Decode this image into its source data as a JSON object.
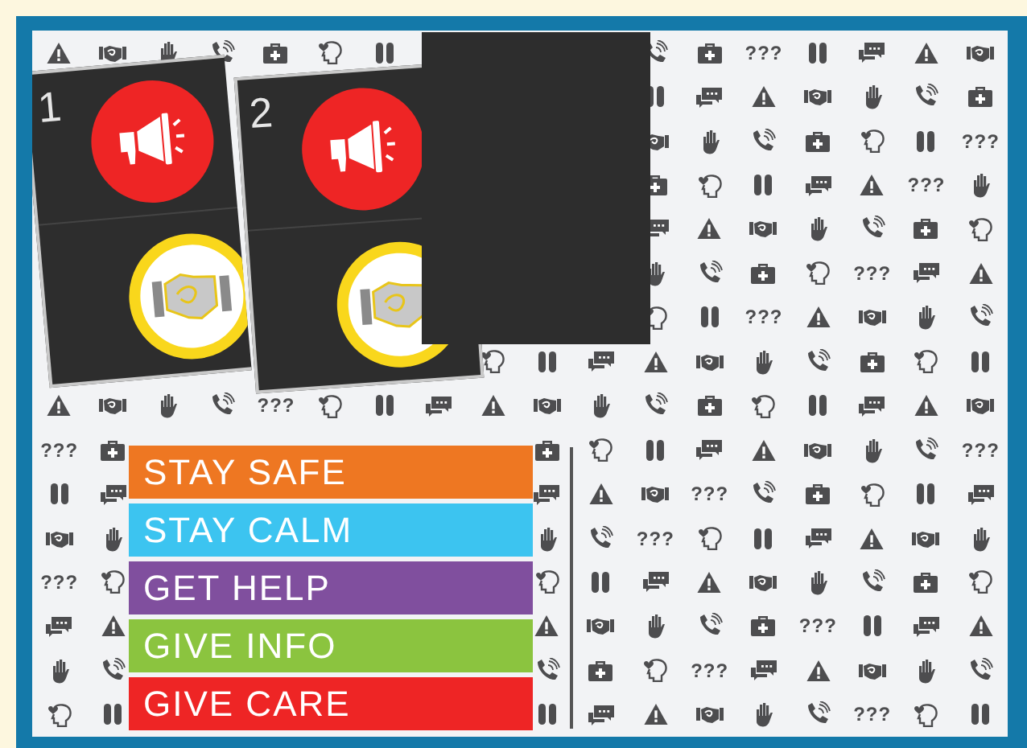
{
  "cards": [
    {
      "number": "1"
    },
    {
      "number": "2"
    }
  ],
  "pattern_marks": [
    "???",
    "???",
    "???",
    "???",
    "???",
    "???",
    "???",
    "???",
    "???",
    "???",
    "???",
    "???",
    "???",
    "???"
  ],
  "buttons": [
    {
      "label": "STAY SAFE",
      "color": "#ee7722"
    },
    {
      "label": "STAY CALM",
      "color": "#3cc4f0"
    },
    {
      "label": "GET HELP",
      "color": "#804f9e"
    },
    {
      "label": "GIVE INFO",
      "color": "#8bc43f"
    },
    {
      "label": "GIVE CARE",
      "color": "#ee2525"
    }
  ]
}
